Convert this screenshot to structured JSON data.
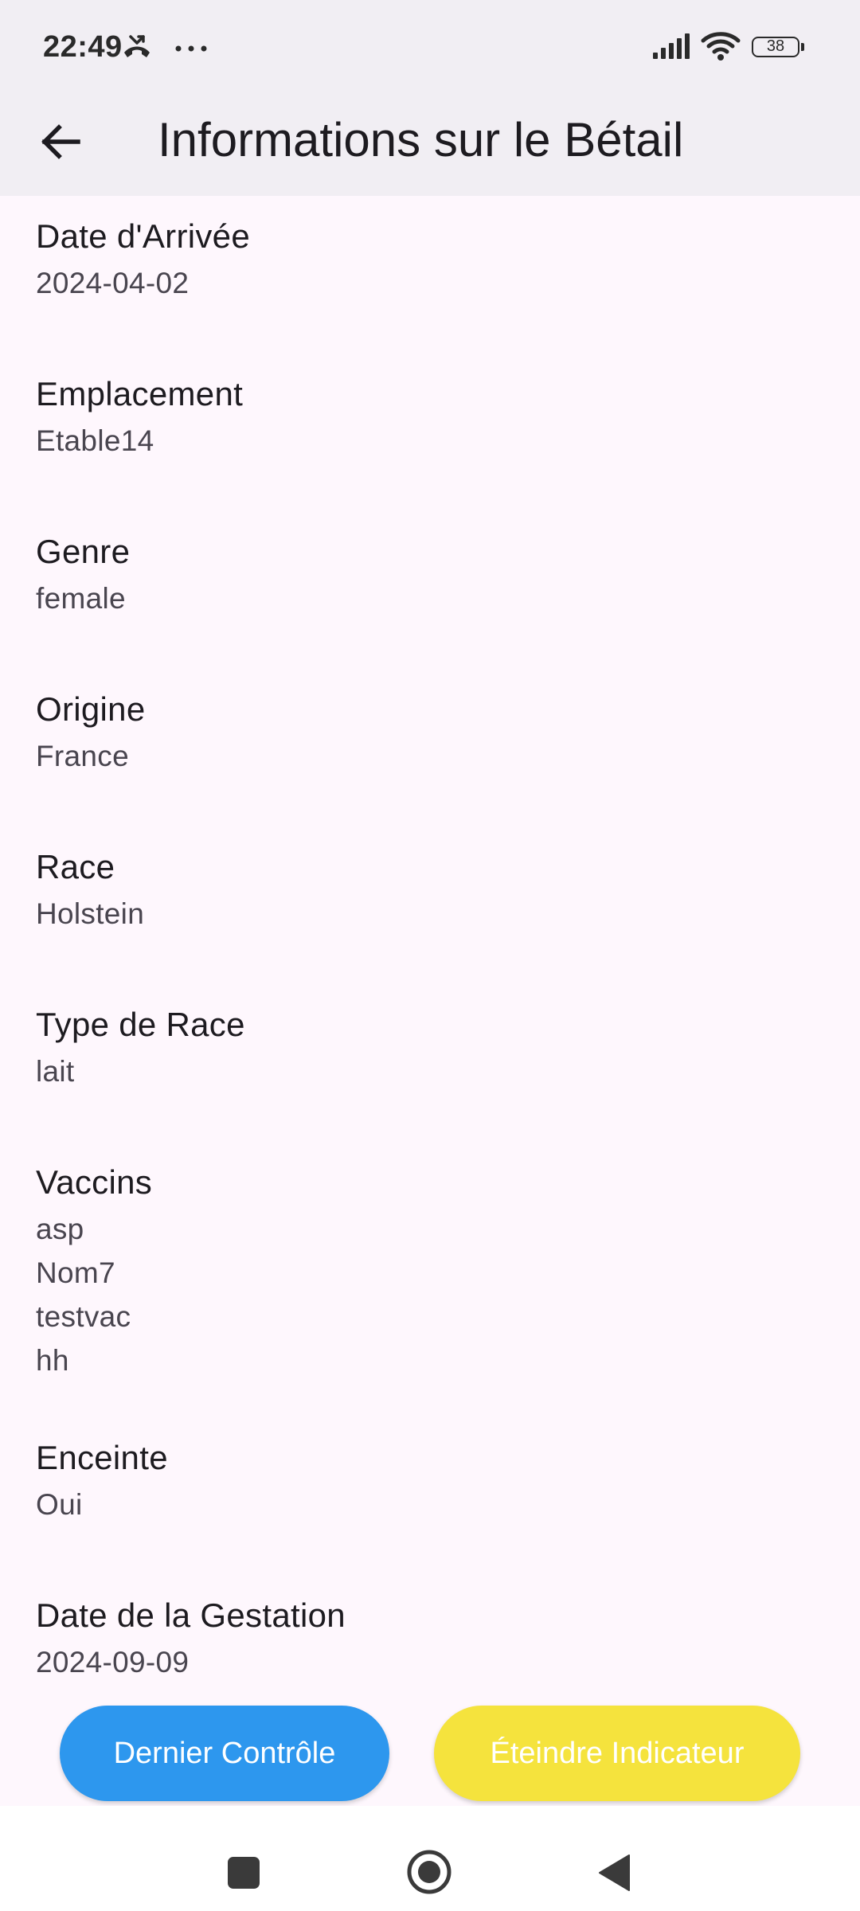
{
  "status_bar": {
    "time": "22:49",
    "battery_level": "38",
    "icons": [
      "missed-call-icon",
      "more-dots-icon",
      "signal-icon",
      "wifi-icon",
      "battery-icon"
    ]
  },
  "app_bar": {
    "title": "Informations sur le Bétail",
    "back_icon": "arrow-left-icon"
  },
  "fields": {
    "date_arrivee": {
      "label": "Date d'Arrivée",
      "value": "2024-04-02"
    },
    "emplacement": {
      "label": "Emplacement",
      "value": "Etable14"
    },
    "genre": {
      "label": "Genre",
      "value": "female"
    },
    "origine": {
      "label": "Origine",
      "value": "France"
    },
    "race": {
      "label": "Race",
      "value": "Holstein"
    },
    "type_race": {
      "label": "Type de Race",
      "value": "lait"
    },
    "vaccins": {
      "label": "Vaccins",
      "values": [
        "asp",
        "Nom7",
        "testvac",
        "hh"
      ]
    },
    "enceinte": {
      "label": "Enceinte",
      "value": "Oui"
    },
    "date_gestation": {
      "label": "Date de la Gestation",
      "value": "2024-09-09"
    }
  },
  "actions": {
    "dernier_controle": "Dernier Contrôle",
    "eteindre_indicateur": "Éteindre Indicateur"
  },
  "colors": {
    "background": "#FEF7FD",
    "app_bar": "#F1EEF3",
    "primary_button": "#2D97EE",
    "secondary_button": "#F5E33D"
  },
  "nav_bar": {
    "icons": [
      "recents-square-icon",
      "home-circle-icon",
      "back-triangle-icon"
    ]
  }
}
